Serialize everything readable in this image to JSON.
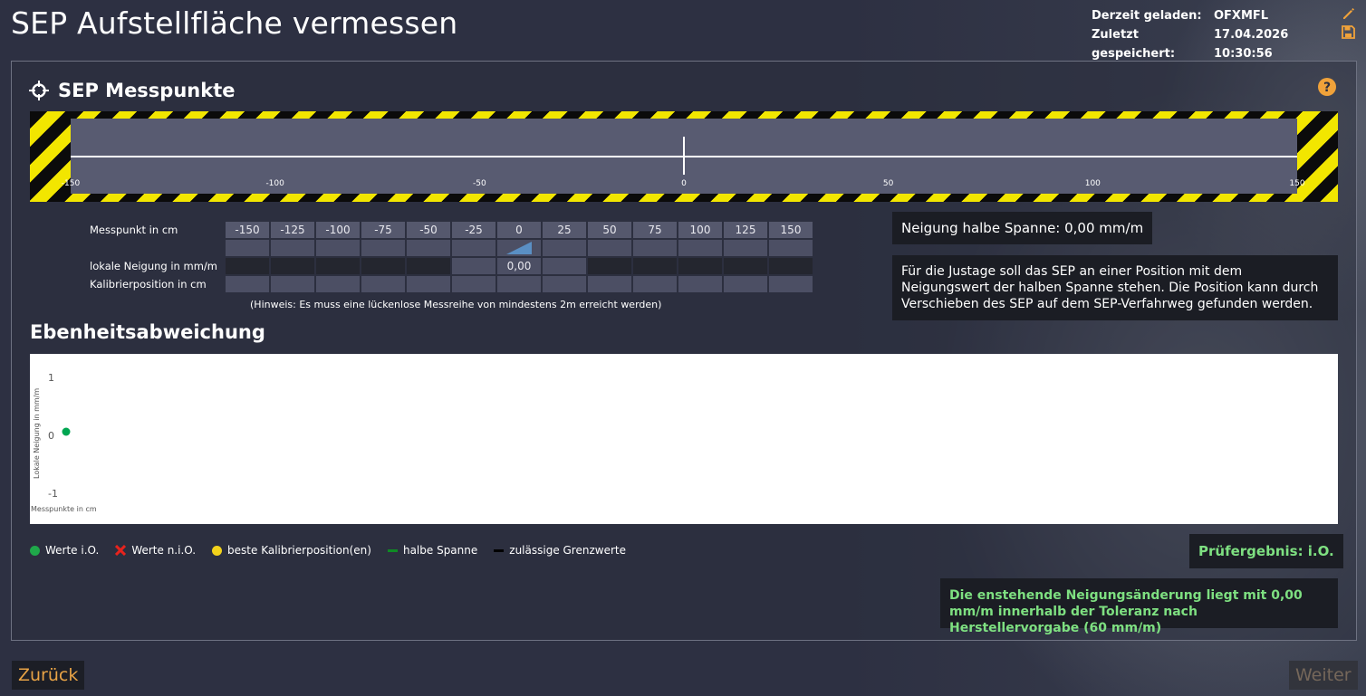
{
  "page": {
    "title": "SEP Aufstellfläche vermessen"
  },
  "status": {
    "loaded_label": "Derzeit geladen:",
    "loaded_value": "OFXMFL",
    "saved_label": "Zuletzt gespeichert:",
    "saved_value": "17.04.2026 10:30:56"
  },
  "icons": {
    "edit": "pencil-icon",
    "save": "save-icon",
    "help": "help-icon",
    "crosshair": "crosshair-icon",
    "accent": "#f0a23a"
  },
  "section_points": {
    "title": "SEP Messpunkte"
  },
  "ruler": {
    "ticks": [
      "-150",
      "-100",
      "-50",
      "0",
      "50",
      "100",
      "150"
    ],
    "marker_position_cm": 0,
    "range_cm": [
      -150,
      150
    ]
  },
  "table": {
    "row_labels": [
      "Messpunkt in cm",
      "",
      "lokale Neigung in mm/m",
      "Kalibrierposition in cm"
    ],
    "columns": [
      "-150",
      "-125",
      "-100",
      "-75",
      "-50",
      "-25",
      "0",
      "25",
      "50",
      "75",
      "100",
      "125",
      "150"
    ],
    "slope_values": [
      "",
      "",
      "",
      "",
      "",
      "",
      "0,00",
      "",
      "",
      "",
      "",
      "",
      ""
    ],
    "hint": "(Hinweis: Es muss eine lückenlose Messreihe von mindestens 2m erreicht werden)"
  },
  "half_span": {
    "text": "Neigung halbe Spanne: 0,00 mm/m"
  },
  "info": {
    "text": "Für die Justage soll das SEP an einer Position mit dem Neigungswert der halben Spanne stehen. Die Position kann durch Verschieben des SEP auf dem SEP-Verfahrweg gefunden werden."
  },
  "section_flatness": {
    "title": "Ebenheitsabweichung"
  },
  "chart_data": {
    "type": "scatter",
    "title": "",
    "xlabel": "Messpunkte in cm",
    "ylabel": "Lokale Neigung in mm/m",
    "ylim": [
      -1,
      1
    ],
    "yticks": [
      "1",
      "0",
      "-1"
    ],
    "grid": false,
    "series": [
      {
        "name": "Werte i.O.",
        "color": "#00a651",
        "points": [
          {
            "x": 0,
            "y": 0
          }
        ]
      }
    ]
  },
  "legend": {
    "items": [
      {
        "label": "Werte i.O.",
        "kind": "dot",
        "color": "#1fa84a"
      },
      {
        "label": "Werte n.i.O.",
        "kind": "cross",
        "color": "#e8231d"
      },
      {
        "label": "beste Kalibrierposition(en)",
        "kind": "dot",
        "color": "#f2d21b"
      },
      {
        "label": "halbe Spanne",
        "kind": "line",
        "color": "#0f8a24"
      },
      {
        "label": "zulässige Grenzwerte",
        "kind": "line",
        "color": "#000000"
      }
    ]
  },
  "result": {
    "label": "Prüfergebnis: i.O.",
    "message": "Die enstehende Neigungsänderung liegt mit 0,00 mm/m innerhalb der Toleranz nach Herstellervorgabe (60 mm/m)",
    "color": "#7ee081"
  },
  "nav": {
    "back": "Zurück",
    "next": "Weiter"
  }
}
